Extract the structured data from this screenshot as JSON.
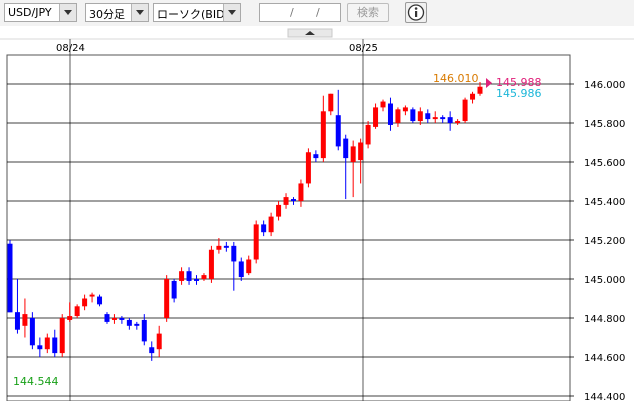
{
  "toolbar": {
    "currency_pair": "USD/JPY",
    "timeframe": "30分足",
    "chart_type": "ローソク(BID)",
    "date_sep1": "/",
    "date_sep2": "/",
    "search_label": "検索",
    "info_icon": "info-icon"
  },
  "scroll_icon": "triangle-up-icon",
  "chart_data": {
    "type": "candlestick",
    "dates": [
      "08/24",
      "08/25"
    ],
    "ylim": [
      144.4,
      146.0
    ],
    "y_ticks": [
      "146.000",
      "145.800",
      "145.600",
      "145.400",
      "145.200",
      "145.000",
      "144.800",
      "144.600",
      "144.400"
    ],
    "labels": {
      "high": "146.010",
      "ask": "145.988",
      "bid": "145.986",
      "low": "144.544"
    },
    "colors": {
      "up": "#ff0000",
      "down": "#0000ff",
      "high_label": "#d97a00",
      "ask_label": "#e0207a",
      "bid_label": "#1ab6d8",
      "low_label": "#18a018"
    },
    "candles": [
      [
        145.181,
        144.829,
        145.2,
        144.83
      ],
      [
        144.83,
        144.74,
        145.0,
        144.72
      ],
      [
        144.76,
        144.82,
        144.9,
        144.7
      ],
      [
        144.8,
        144.66,
        144.83,
        144.64
      ],
      [
        144.66,
        144.64,
        144.7,
        144.6
      ],
      [
        144.64,
        144.7,
        144.72,
        144.62
      ],
      [
        144.7,
        144.62,
        144.74,
        144.6
      ],
      [
        144.62,
        144.8,
        144.82,
        144.6
      ],
      [
        144.79,
        144.81,
        144.88,
        144.78
      ],
      [
        144.81,
        144.86,
        144.87,
        144.8
      ],
      [
        144.86,
        144.9,
        144.92,
        144.84
      ],
      [
        144.91,
        144.92,
        144.93,
        144.88
      ],
      [
        144.91,
        144.87,
        144.92,
        144.86
      ],
      [
        144.82,
        144.78,
        144.83,
        144.77
      ],
      [
        144.79,
        144.8,
        144.82,
        144.77
      ],
      [
        144.8,
        144.79,
        144.81,
        144.77
      ],
      [
        144.79,
        144.76,
        144.8,
        144.74
      ],
      [
        144.77,
        144.76,
        144.78,
        144.74
      ],
      [
        144.79,
        144.68,
        144.82,
        144.66
      ],
      [
        144.65,
        144.62,
        144.68,
        144.58
      ],
      [
        144.64,
        144.72,
        144.76,
        144.6
      ],
      [
        144.8,
        145.0,
        145.02,
        144.78
      ],
      [
        144.99,
        144.9,
        145.0,
        144.88
      ],
      [
        144.99,
        145.04,
        145.06,
        144.97
      ],
      [
        145.04,
        144.99,
        145.06,
        144.97
      ],
      [
        145.0,
        144.99,
        145.02,
        144.97
      ],
      [
        145.0,
        145.02,
        145.03,
        144.99
      ],
      [
        145.0,
        145.15,
        145.17,
        144.98
      ],
      [
        145.15,
        145.17,
        145.21,
        145.13
      ],
      [
        145.17,
        145.16,
        145.19,
        145.14
      ],
      [
        145.17,
        145.09,
        145.19,
        144.94
      ],
      [
        145.09,
        145.01,
        145.11,
        144.99
      ],
      [
        145.03,
        145.1,
        145.12,
        145.02
      ],
      [
        145.1,
        145.28,
        145.3,
        145.08
      ],
      [
        145.28,
        145.24,
        145.3,
        145.22
      ],
      [
        145.24,
        145.32,
        145.34,
        145.22
      ],
      [
        145.32,
        145.38,
        145.4,
        145.3
      ],
      [
        145.38,
        145.42,
        145.44,
        145.36
      ],
      [
        145.41,
        145.4,
        145.42,
        145.38
      ],
      [
        145.4,
        145.49,
        145.51,
        145.37
      ],
      [
        145.49,
        145.65,
        145.67,
        145.47
      ],
      [
        145.64,
        145.62,
        145.66,
        145.6
      ],
      [
        145.62,
        145.86,
        145.94,
        145.6
      ],
      [
        145.86,
        145.95,
        145.95,
        145.84
      ],
      [
        145.84,
        145.68,
        145.97,
        145.66
      ],
      [
        145.72,
        145.62,
        145.74,
        145.41
      ],
      [
        145.6,
        145.68,
        145.71,
        145.42
      ],
      [
        145.61,
        145.7,
        145.72,
        145.49
      ],
      [
        145.69,
        145.79,
        145.81,
        145.67
      ],
      [
        145.78,
        145.88,
        145.9,
        145.77
      ],
      [
        145.88,
        145.91,
        145.92,
        145.86
      ],
      [
        145.9,
        145.79,
        145.93,
        145.76
      ],
      [
        145.8,
        145.87,
        145.88,
        145.78
      ],
      [
        145.86,
        145.88,
        145.89,
        145.84
      ],
      [
        145.87,
        145.81,
        145.88,
        145.8
      ],
      [
        145.81,
        145.86,
        145.88,
        145.79
      ],
      [
        145.85,
        145.82,
        145.87,
        145.8
      ],
      [
        145.82,
        145.83,
        145.86,
        145.8
      ],
      [
        145.83,
        145.82,
        145.84,
        145.8
      ],
      [
        145.83,
        145.8,
        145.86,
        145.76
      ],
      [
        145.8,
        145.81,
        145.82,
        145.79
      ],
      [
        145.81,
        145.92,
        145.93,
        145.8
      ],
      [
        145.92,
        145.95,
        145.96,
        145.9
      ],
      [
        145.95,
        145.986,
        146.01,
        145.94
      ]
    ]
  }
}
